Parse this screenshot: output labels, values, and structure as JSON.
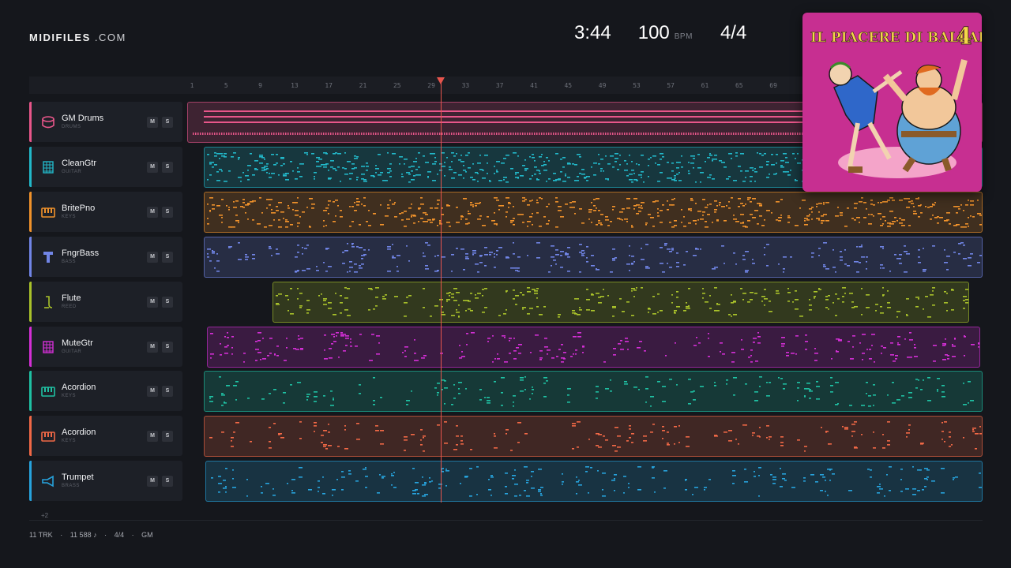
{
  "brand": {
    "name": "MIDIFILES",
    "suffix": " .COM"
  },
  "transport": {
    "time": "3:44",
    "tempo": "100",
    "tempo_unit": "BPM",
    "signature": "4/4"
  },
  "ruler": [
    "1",
    "5",
    "9",
    "13",
    "17",
    "21",
    "25",
    "29",
    "33",
    "37",
    "41",
    "45",
    "49",
    "53",
    "57",
    "61",
    "65",
    "69"
  ],
  "tracks": [
    {
      "name": "GM Drums",
      "category": "DRUMS",
      "color": "#e8568a",
      "icon": "drum-icon",
      "mute": "M",
      "solo": "S"
    },
    {
      "name": "CleanGtr",
      "category": "GUITAR",
      "color": "#22b8c9",
      "icon": "guitar-fretboard-icon",
      "mute": "M",
      "solo": "S"
    },
    {
      "name": "BritePno",
      "category": "KEYS",
      "color": "#f0922b",
      "icon": "piano-keys-icon",
      "mute": "M",
      "solo": "S"
    },
    {
      "name": "FngrBass",
      "category": "BASS",
      "color": "#7185e6",
      "icon": "bass-icon",
      "mute": "M",
      "solo": "S"
    },
    {
      "name": "Flute",
      "category": "REED",
      "color": "#a9c22a",
      "icon": "flute-icon",
      "mute": "M",
      "solo": "S"
    },
    {
      "name": "MuteGtr",
      "category": "GUITAR",
      "color": "#d42fd6",
      "icon": "guitar-fretboard-icon",
      "mute": "M",
      "solo": "S"
    },
    {
      "name": "Acordion",
      "category": "KEYS",
      "color": "#1fc1a3",
      "icon": "piano-keys-icon",
      "mute": "M",
      "solo": "S"
    },
    {
      "name": "Acordion",
      "category": "KEYS",
      "color": "#f06846",
      "icon": "piano-keys-icon",
      "mute": "M",
      "solo": "S"
    },
    {
      "name": "Trumpet",
      "category": "BRASS",
      "color": "#27a3dd",
      "icon": "trumpet-icon",
      "mute": "M",
      "solo": "S"
    }
  ],
  "more_tracks": "+2",
  "footer": {
    "tracks": "11 TRK",
    "sep": "·",
    "notes": "11 588 ♪",
    "signature": "4/4",
    "standard": "GM"
  },
  "album": {
    "title": "IL PIACERE DI BALLARE",
    "number": "4",
    "bg": "#c72f91"
  }
}
